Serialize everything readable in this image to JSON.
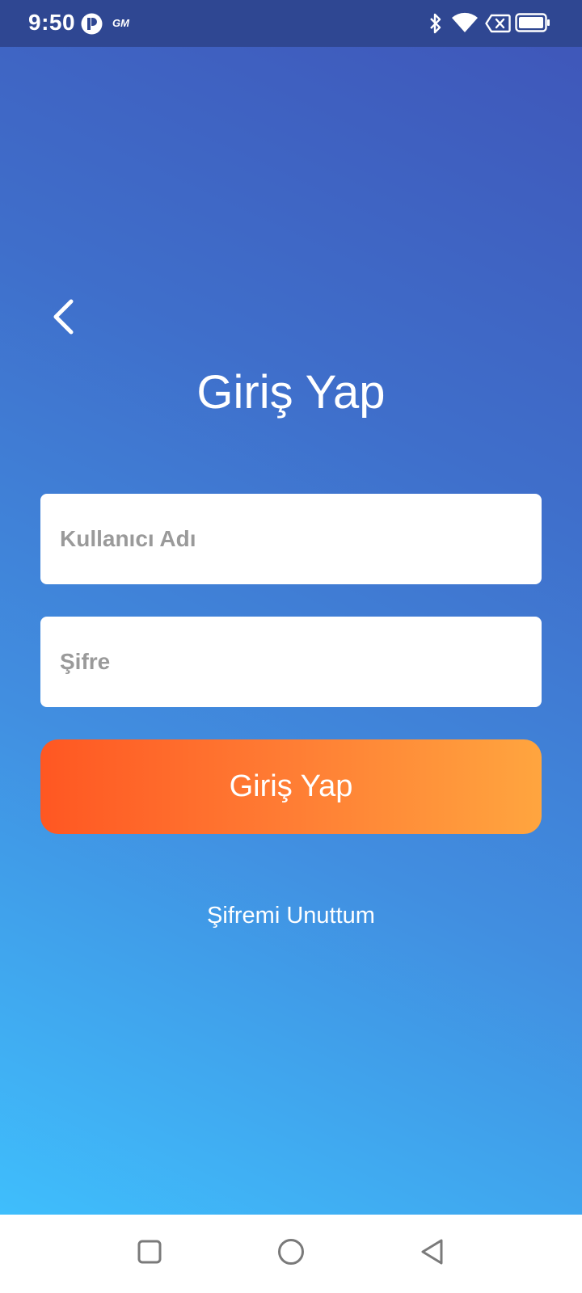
{
  "status_bar": {
    "time": "9:50",
    "icons": [
      "app-notification-icon",
      "gm-icon",
      "bluetooth-icon",
      "wifi-icon",
      "no-sim-icon",
      "battery-icon"
    ],
    "gm_text": "GM"
  },
  "header": {
    "back_icon": "chevron-left-icon",
    "title": "Giriş Yap"
  },
  "form": {
    "username_placeholder": "Kullanıcı Adı",
    "username_value": "",
    "password_placeholder": "Şifre",
    "password_value": "",
    "login_label": "Giriş Yap",
    "forgot_label": "Şifremi Unuttum"
  },
  "nav_bar": {
    "buttons": [
      "recents-square-icon",
      "home-circle-icon",
      "back-triangle-icon"
    ]
  },
  "colors": {
    "gradient_top": "#3f55b8",
    "gradient_bottom": "#3fbefc",
    "button_start": "#ff5722",
    "button_end": "#ffa53f",
    "text_on_background": "#ffffff",
    "placeholder": "#9a9a9a"
  }
}
